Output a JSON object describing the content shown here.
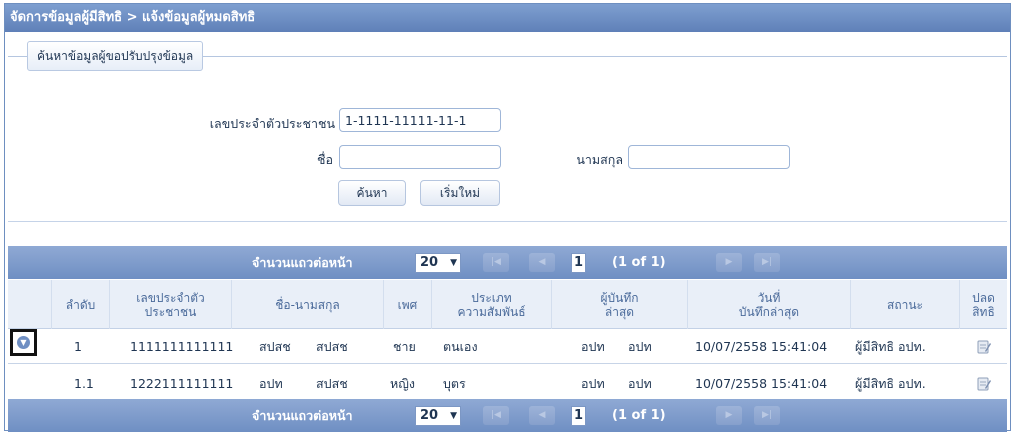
{
  "breadcrumb": "จัดการข้อมูลผู้มีสิทธิ > แจ้งข้อมูลผู้หมดสิทธิ",
  "search": {
    "legend": "ค้นหาข้อมูลผู้ขอปรับปรุงข้อมูล",
    "id_label": "เลขประจำตัวประชาชน",
    "id_value": "1-1111-11111-11-1",
    "name_label": "ชื่อ",
    "name_value": "",
    "surname_label": "นามสกุล",
    "surname_value": "",
    "search_button": "ค้นหา",
    "reset_button": "เริ่มใหม่"
  },
  "pager": {
    "rows_per_page_label": "จำนวนแถวต่อหน้า",
    "rows_per_page": "20",
    "page": "1",
    "page_of": "(1 of 1)",
    "first_icon": "first-page-icon",
    "prev_icon": "prev-page-icon",
    "next_icon": "next-page-icon",
    "last_icon": "last-page-icon"
  },
  "table": {
    "headers": {
      "seq": "ลำดับ",
      "id_line1": "เลขประจำตัว",
      "id_line2": "ประชาชน",
      "name": "ชื่อ-นามสกุล",
      "gender": "เพศ",
      "type_line1": "ประเภท",
      "type_line2": "ความสัมพันธ์",
      "recorder_line1": "ผู้บันทึก",
      "recorder_line2": "ล่าสุด",
      "date_line1": "วันที่",
      "date_line2": "บันทึกล่าสุด",
      "status": "สถานะ",
      "revoke_line1": "ปลด",
      "revoke_line2": "สิทธิ"
    },
    "rows": [
      {
        "seq": "1",
        "id": "1111111111111",
        "first": "สปสช",
        "last": "สปสช",
        "gender": "ชาย",
        "type": "ตนเอง",
        "rec_first": "อปท",
        "rec_last": "อปท",
        "date": "10/07/2558 15:41:04",
        "status": "ผู้มีสิทธิ อปท."
      },
      {
        "seq": "1.1",
        "id": "1222111111111",
        "first": "อปท",
        "last": "สปสช",
        "gender": "หญิง",
        "type": "บุตร",
        "rec_first": "อปท",
        "rec_last": "อปท",
        "date": "10/07/2558 15:41:04",
        "status": "ผู้มีสิทธิ อปท."
      }
    ]
  },
  "icons": {
    "expand": "expand-row-icon",
    "edit": "edit-note-icon"
  },
  "colors": {
    "header_blue": "#6f8fc3",
    "title_blue": "#5f80b8",
    "text": "#1f3552"
  }
}
